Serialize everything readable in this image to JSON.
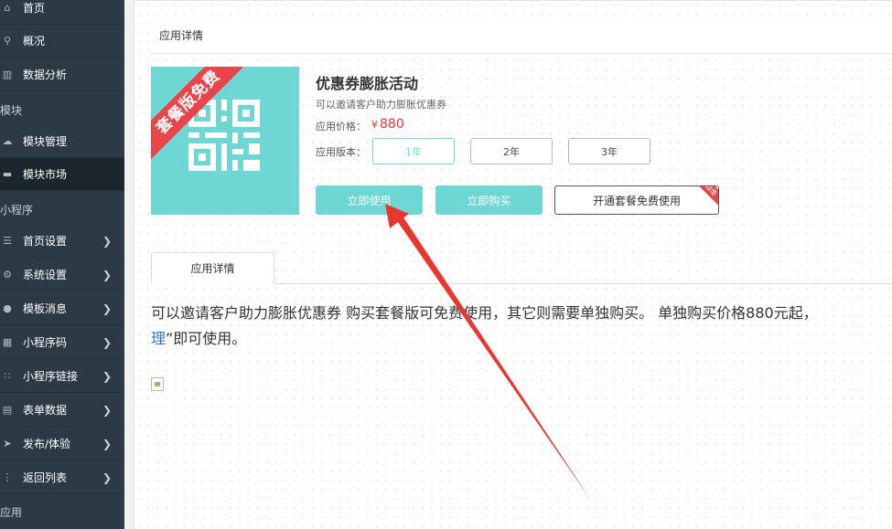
{
  "sidebar": {
    "items": [
      {
        "label": "首页",
        "icon": "home-icon",
        "chevron": false,
        "active": false
      },
      {
        "label": "概况",
        "icon": "overview-icon",
        "chevron": false,
        "active": false
      },
      {
        "label": "数据分析",
        "icon": "chart-icon",
        "chevron": false,
        "active": false
      },
      {
        "label": "模块管理",
        "icon": "cloud-icon",
        "chevron": false,
        "active": false
      },
      {
        "label": "模块市场",
        "icon": "market-icon",
        "chevron": false,
        "active": true
      },
      {
        "label": "首页设置",
        "icon": "list-icon",
        "chevron": true,
        "active": false
      },
      {
        "label": "系统设置",
        "icon": "network-icon",
        "chevron": true,
        "active": false
      },
      {
        "label": "模板消息",
        "icon": "message-icon",
        "chevron": true,
        "active": false
      },
      {
        "label": "小程序码",
        "icon": "qrcode-icon",
        "chevron": true,
        "active": false
      },
      {
        "label": "小程序链接",
        "icon": "link-icon",
        "chevron": true,
        "active": false
      },
      {
        "label": "表单数据",
        "icon": "form-icon",
        "chevron": true,
        "active": false
      },
      {
        "label": "发布/体验",
        "icon": "publish-icon",
        "chevron": true,
        "active": false
      },
      {
        "label": "返回列表",
        "icon": "back-list-icon",
        "chevron": true,
        "active": false
      }
    ],
    "sections": {
      "module": "模块",
      "miniprogram": "小程序",
      "app": "应用"
    }
  },
  "panel": {
    "title": "应用详情"
  },
  "app": {
    "ribbon": "套餐版免费",
    "name": "优惠券膨胀活动",
    "description": "可以邀请客户助力膨胀优惠券",
    "price_label": "应用价格：",
    "price_symbol": "¥",
    "price_value": "880",
    "version_label": "应用版本：",
    "versions": [
      "1年",
      "2年",
      "3年"
    ],
    "selected_version": "1年",
    "use_now": "立即使用",
    "buy_now": "立即购买",
    "package_free": "开通套餐免费使用",
    "corner_badge": "超值"
  },
  "tabs": [
    {
      "label": "应用详情"
    }
  ],
  "detail": {
    "text_main": "可以邀请客户助力膨胀优惠券 购买套餐版可免费使用，其它则需要单独购买。 单独购买价格880元起，",
    "text_link": "理",
    "text_tail": "”即可使用。"
  },
  "colors": {
    "accent": "#6fd7d3",
    "sidebar": "#2b3a44",
    "sidebar_active": "#1b262d",
    "price": "#e33333",
    "ribbon": "#e9444a",
    "arrow": "#e8372f"
  }
}
